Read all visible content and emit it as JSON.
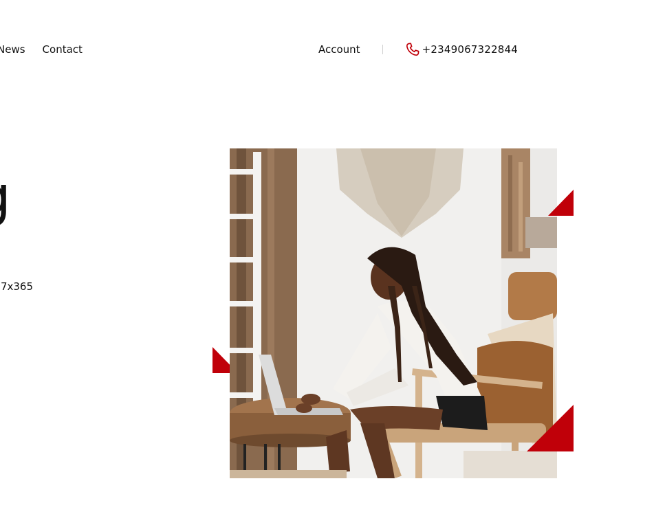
{
  "nav": {
    "items": [
      {
        "label": "News"
      },
      {
        "label": "Contact"
      }
    ]
  },
  "header": {
    "account_label": "Account",
    "phone_number": "+2349067322844",
    "phone_icon": "phone-icon"
  },
  "hero": {
    "heading_fragment": "g",
    "subtext_fragment": "7x365"
  },
  "colors": {
    "accent": "#c00009",
    "text": "#111111",
    "divider": "#cfcfcf",
    "background": "#ffffff"
  },
  "image": {
    "subject": "photo"
  }
}
